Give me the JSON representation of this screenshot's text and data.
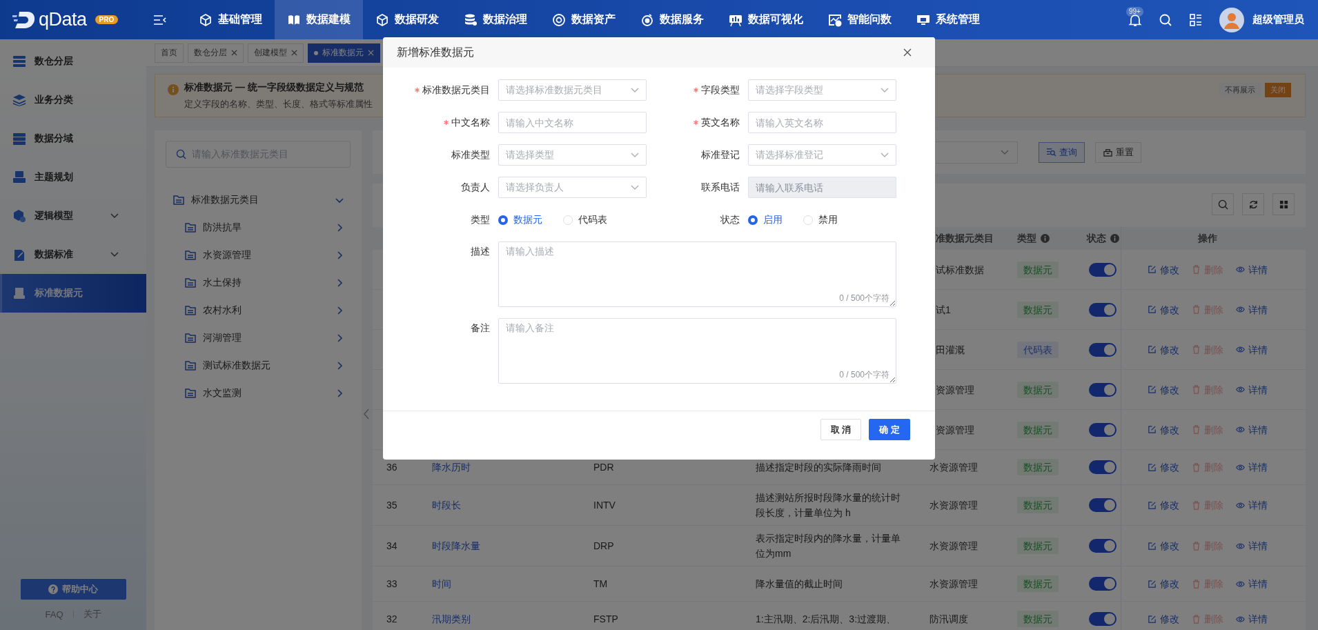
{
  "brand": {
    "name": "qData",
    "badge": "PRO"
  },
  "top_menu": [
    {
      "label": "基础管理",
      "selected": false
    },
    {
      "label": "数据建模",
      "selected": true
    },
    {
      "label": "数据研发",
      "selected": false
    },
    {
      "label": "数据治理",
      "selected": false
    },
    {
      "label": "数据资产",
      "selected": false
    },
    {
      "label": "数据服务",
      "selected": false
    },
    {
      "label": "数据可视化",
      "selected": false
    },
    {
      "label": "智能问数",
      "selected": false
    },
    {
      "label": "系统管理",
      "selected": false
    }
  ],
  "notifications": {
    "badge": "99+"
  },
  "user": {
    "name": "超级管理员"
  },
  "sidebar": {
    "items": [
      {
        "label": "数仓分层",
        "selected": false,
        "expandable": false
      },
      {
        "label": "业务分类",
        "selected": false,
        "expandable": false
      },
      {
        "label": "数据分域",
        "selected": false,
        "expandable": false
      },
      {
        "label": "主题规划",
        "selected": false,
        "expandable": false
      },
      {
        "label": "逻辑模型",
        "selected": false,
        "expandable": true
      },
      {
        "label": "数据标准",
        "selected": false,
        "expandable": true
      },
      {
        "label": "标准数据元",
        "selected": true,
        "expandable": false
      }
    ],
    "help_button": "帮助中心",
    "links": [
      "FAQ",
      "关于"
    ]
  },
  "tabs": [
    {
      "label": "首页",
      "closable": false,
      "selected": false
    },
    {
      "label": "数仓分层",
      "closable": true,
      "selected": false
    },
    {
      "label": "创建模型",
      "closable": true,
      "selected": false
    },
    {
      "label": "标准数据元",
      "closable": true,
      "selected": true
    }
  ],
  "alert": {
    "title": "标准数据元 — 统一字段级数据定义与规范",
    "text": "定义字段的名称、类型、长度、格式等标准属性",
    "buttons": [
      {
        "label": "不再展示",
        "primary": false
      },
      {
        "label": "关闭",
        "primary": true
      }
    ]
  },
  "tree": {
    "search_placeholder": "请输入标准数据元类目",
    "root": {
      "label": "标准数据元类目",
      "expanded": true,
      "children": [
        {
          "label": "防洪抗旱"
        },
        {
          "label": "水资源管理"
        },
        {
          "label": "水土保持"
        },
        {
          "label": "农村水利"
        },
        {
          "label": "河湖管理"
        },
        {
          "label": "测试标准数据元"
        },
        {
          "label": "水文监测"
        }
      ]
    }
  },
  "filter": {
    "buttons": [
      {
        "label": "查询",
        "primary": true
      },
      {
        "label": "重置",
        "primary": false
      }
    ]
  },
  "table": {
    "columns": [
      {
        "label": "准数据元类目",
        "info": false
      },
      {
        "label": "类型",
        "info": true
      },
      {
        "label": "状态",
        "info": true
      },
      {
        "label": "操作",
        "info": false
      }
    ],
    "rows": [
      {
        "category": "试标准数据",
        "type": {
          "label": "数据元",
          "kind": "element"
        },
        "status_on": true,
        "actions": [
          {
            "label": "修改",
            "kind": "edit"
          },
          {
            "label": "删除",
            "kind": "delete"
          },
          {
            "label": "详情",
            "kind": "view"
          }
        ]
      },
      {
        "category": "试1",
        "type": {
          "label": "数据元",
          "kind": "element"
        },
        "status_on": true,
        "actions": [
          {
            "label": "修改",
            "kind": "edit"
          },
          {
            "label": "删除",
            "kind": "delete"
          },
          {
            "label": "详情",
            "kind": "view"
          }
        ]
      },
      {
        "category": "田灌溉",
        "type": {
          "label": "代码表",
          "kind": "code"
        },
        "status_on": true,
        "actions": [
          {
            "label": "修改",
            "kind": "edit"
          },
          {
            "label": "删除",
            "kind": "delete"
          },
          {
            "label": "详情",
            "kind": "view"
          }
        ]
      },
      {
        "category": "资源管理",
        "type": {
          "label": "数据元",
          "kind": "element"
        },
        "status_on": true,
        "actions": [
          {
            "label": "修改",
            "kind": "edit"
          },
          {
            "label": "删除",
            "kind": "delete"
          },
          {
            "label": "详情",
            "kind": "view"
          }
        ]
      },
      {
        "category": "资源管理",
        "type": {
          "label": "数据元",
          "kind": "element"
        },
        "status_on": true,
        "actions": [
          {
            "label": "修改",
            "kind": "edit"
          },
          {
            "label": "删除",
            "kind": "delete"
          },
          {
            "label": "详情",
            "kind": "view"
          }
        ]
      },
      {
        "index": "36",
        "name": "降水历时",
        "code": "PDR",
        "description": "描述指定时段的实际降雨时间",
        "category": "水资源管理",
        "type": {
          "label": "数据元",
          "kind": "element"
        },
        "status_on": true,
        "actions": [
          {
            "label": "修改",
            "kind": "edit"
          },
          {
            "label": "删除",
            "kind": "delete"
          },
          {
            "label": "详情",
            "kind": "view"
          }
        ]
      },
      {
        "index": "35",
        "name": "时段长",
        "code": "INTV",
        "description": "描述测站所报时段降水量的统计时段长度，计量单位为 h",
        "category": "水资源管理",
        "type": {
          "label": "数据元",
          "kind": "element"
        },
        "status_on": true,
        "actions": [
          {
            "label": "修改",
            "kind": "edit"
          },
          {
            "label": "删除",
            "kind": "delete"
          },
          {
            "label": "详情",
            "kind": "view"
          }
        ]
      },
      {
        "index": "34",
        "name": "时段降水量",
        "code": "DRP",
        "description": "表示指定时段内的降水量，计量单位为mm",
        "category": "水资源管理",
        "type": {
          "label": "数据元",
          "kind": "element"
        },
        "status_on": true,
        "actions": [
          {
            "label": "修改",
            "kind": "edit"
          },
          {
            "label": "删除",
            "kind": "delete"
          },
          {
            "label": "详情",
            "kind": "view"
          }
        ]
      },
      {
        "index": "33",
        "name": "时间",
        "code": "TM",
        "description": "降水量值的截止时间",
        "category": "水资源管理",
        "type": {
          "label": "数据元",
          "kind": "element"
        },
        "status_on": true,
        "actions": [
          {
            "label": "修改",
            "kind": "edit"
          },
          {
            "label": "删除",
            "kind": "delete"
          },
          {
            "label": "详情",
            "kind": "view"
          }
        ]
      },
      {
        "index": "32",
        "name": "汛期类别",
        "code": "FSTP",
        "description": "1:主汛期、2:后汛期、3:过渡期、",
        "category": "防汛调度",
        "type": {
          "label": "数据元",
          "kind": "element"
        },
        "status_on": true,
        "actions": [
          {
            "label": "修改",
            "kind": "edit"
          },
          {
            "label": "删除",
            "kind": "delete"
          },
          {
            "label": "详情",
            "kind": "view"
          }
        ]
      }
    ]
  },
  "dialog": {
    "title": "新增标准数据元",
    "fields": [
      {
        "label": "标准数据元类目",
        "required": true,
        "kind": "select",
        "placeholder": "请选择标准数据元类目",
        "disabled": false
      },
      {
        "label": "字段类型",
        "required": true,
        "kind": "select",
        "placeholder": "请选择字段类型",
        "disabled": false
      },
      {
        "label": "中文名称",
        "required": true,
        "kind": "input",
        "placeholder": "请输入中文名称",
        "disabled": false
      },
      {
        "label": "英文名称",
        "required": true,
        "kind": "input",
        "placeholder": "请输入英文名称",
        "disabled": false
      },
      {
        "label": "标准类型",
        "required": false,
        "kind": "select",
        "placeholder": "请选择类型",
        "disabled": false
      },
      {
        "label": "标准登记",
        "required": false,
        "kind": "select",
        "placeholder": "请选择标准登记",
        "disabled": false
      },
      {
        "label": "负责人",
        "required": false,
        "kind": "select",
        "placeholder": "请选择负责人",
        "disabled": false
      },
      {
        "label": "联系电话",
        "required": false,
        "kind": "input",
        "placeholder": "请输入联系电话",
        "disabled": true
      },
      {
        "label": "类型",
        "required": false,
        "kind": "radio",
        "disabled": false,
        "options": [
          {
            "label": "数据元",
            "selected": true
          },
          {
            "label": "代码表",
            "selected": false
          }
        ]
      },
      {
        "label": "状态",
        "required": false,
        "kind": "radio",
        "disabled": false,
        "options": [
          {
            "label": "启用",
            "selected": true
          },
          {
            "label": "禁用",
            "selected": false
          }
        ]
      },
      {
        "label": "描述",
        "required": false,
        "kind": "textarea",
        "placeholder": "请输入描述",
        "counter": "0 / 500个字符",
        "disabled": false
      },
      {
        "label": "备注",
        "required": false,
        "kind": "textarea",
        "placeholder": "请输入备注",
        "counter": "0 / 500个字符",
        "disabled": false
      }
    ],
    "buttons": [
      {
        "label": "取 消",
        "primary": false
      },
      {
        "label": "确 定",
        "primary": true
      }
    ]
  }
}
